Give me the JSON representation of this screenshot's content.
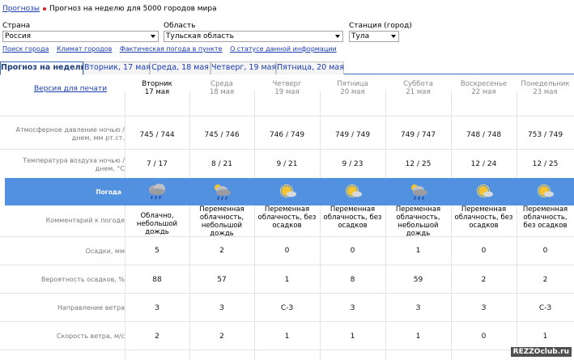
{
  "breadcrumb": {
    "link": "Прогнозы",
    "text": "Прогноз на неделю для 5000 городов мира"
  },
  "filters": {
    "country_label": "Страна",
    "country_value": "Россия",
    "region_label": "Область",
    "region_value": "Тульская область",
    "station_label": "Станция (город)",
    "station_value": "Тула"
  },
  "links": [
    "Поиск города",
    "Климат городов",
    "Фактическая погода в пункте",
    "О статусе данной информации"
  ],
  "tabs": [
    "Прогноз на неделю",
    "Вторник, 17 мая",
    "Среда, 18 мая",
    "Четверг, 19 мая",
    "Пятница, 20 мая"
  ],
  "print_link": "Версия для печати",
  "days": [
    {
      "name": "Вторник",
      "date": "17 мая"
    },
    {
      "name": "Среда",
      "date": "18 мая"
    },
    {
      "name": "Четверг",
      "date": "19 мая"
    },
    {
      "name": "Пятница",
      "date": "20 мая"
    },
    {
      "name": "Суббота",
      "date": "21 мая"
    },
    {
      "name": "Воскресенье",
      "date": "22 мая"
    },
    {
      "name": "Понедельник",
      "date": "23 мая"
    }
  ],
  "rows": {
    "pressure": {
      "label1": "Атмосферное давление ночью /",
      "label2": "днем, мм рт.ст.",
      "values": [
        "745 / 744",
        "745 / 746",
        "746 / 749",
        "749 / 749",
        "749 / 747",
        "748 / 748",
        "753 / 749"
      ]
    },
    "temperature": {
      "label1": "Температура воздуха ночью /",
      "label2": "днем, °С",
      "values": [
        "7 / 17",
        "8 / 21",
        "9 / 21",
        "9 / 23",
        "12 / 25",
        "12 / 24",
        "12 / 25"
      ]
    },
    "weather": {
      "label": "Погода",
      "icons": [
        "cloud-rain-icon",
        "cloud-rain-sun-icon",
        "sun-cloud-icon",
        "sun-cloud-icon",
        "cloud-rain-sun-icon",
        "sun-cloud-icon",
        "sun-cloud-icon"
      ]
    },
    "comment": {
      "label": "Комментарий к погоде",
      "values": [
        [
          "Облачно,",
          "небольшой дождь"
        ],
        [
          "Переменная",
          "облачность,",
          "небольшой дождь"
        ],
        [
          "Переменная",
          "облачность, без",
          "осадков"
        ],
        [
          "Переменная",
          "облачность, без",
          "осадков"
        ],
        [
          "Переменная",
          "облачность,",
          "небольшой дождь"
        ],
        [
          "Переменная",
          "облачность, без",
          "осадков"
        ],
        [
          "Переменная",
          "облачность,",
          "без осадков"
        ]
      ]
    },
    "precip": {
      "label": "Осадки, мм",
      "values": [
        "5",
        "2",
        "0",
        "0",
        "1",
        "0",
        "0"
      ]
    },
    "probability": {
      "label": "Вероятность осадков, %",
      "values": [
        "88",
        "57",
        "1",
        "8",
        "59",
        "2",
        "2"
      ]
    },
    "wind_dir": {
      "label": "Направление ветра",
      "values": [
        "З",
        "З",
        "С-З",
        "З",
        "З",
        "З",
        "С-З"
      ]
    },
    "wind_speed": {
      "label": "Скорость ветра, м/с",
      "values": [
        "2",
        "2",
        "1",
        "1",
        "1",
        "0",
        "1"
      ]
    }
  },
  "watermark": "REZZOclub.ru",
  "colors": {
    "band": "#5290e0",
    "link": "#1a3cb5",
    "tab_border": "#3d6db5"
  }
}
